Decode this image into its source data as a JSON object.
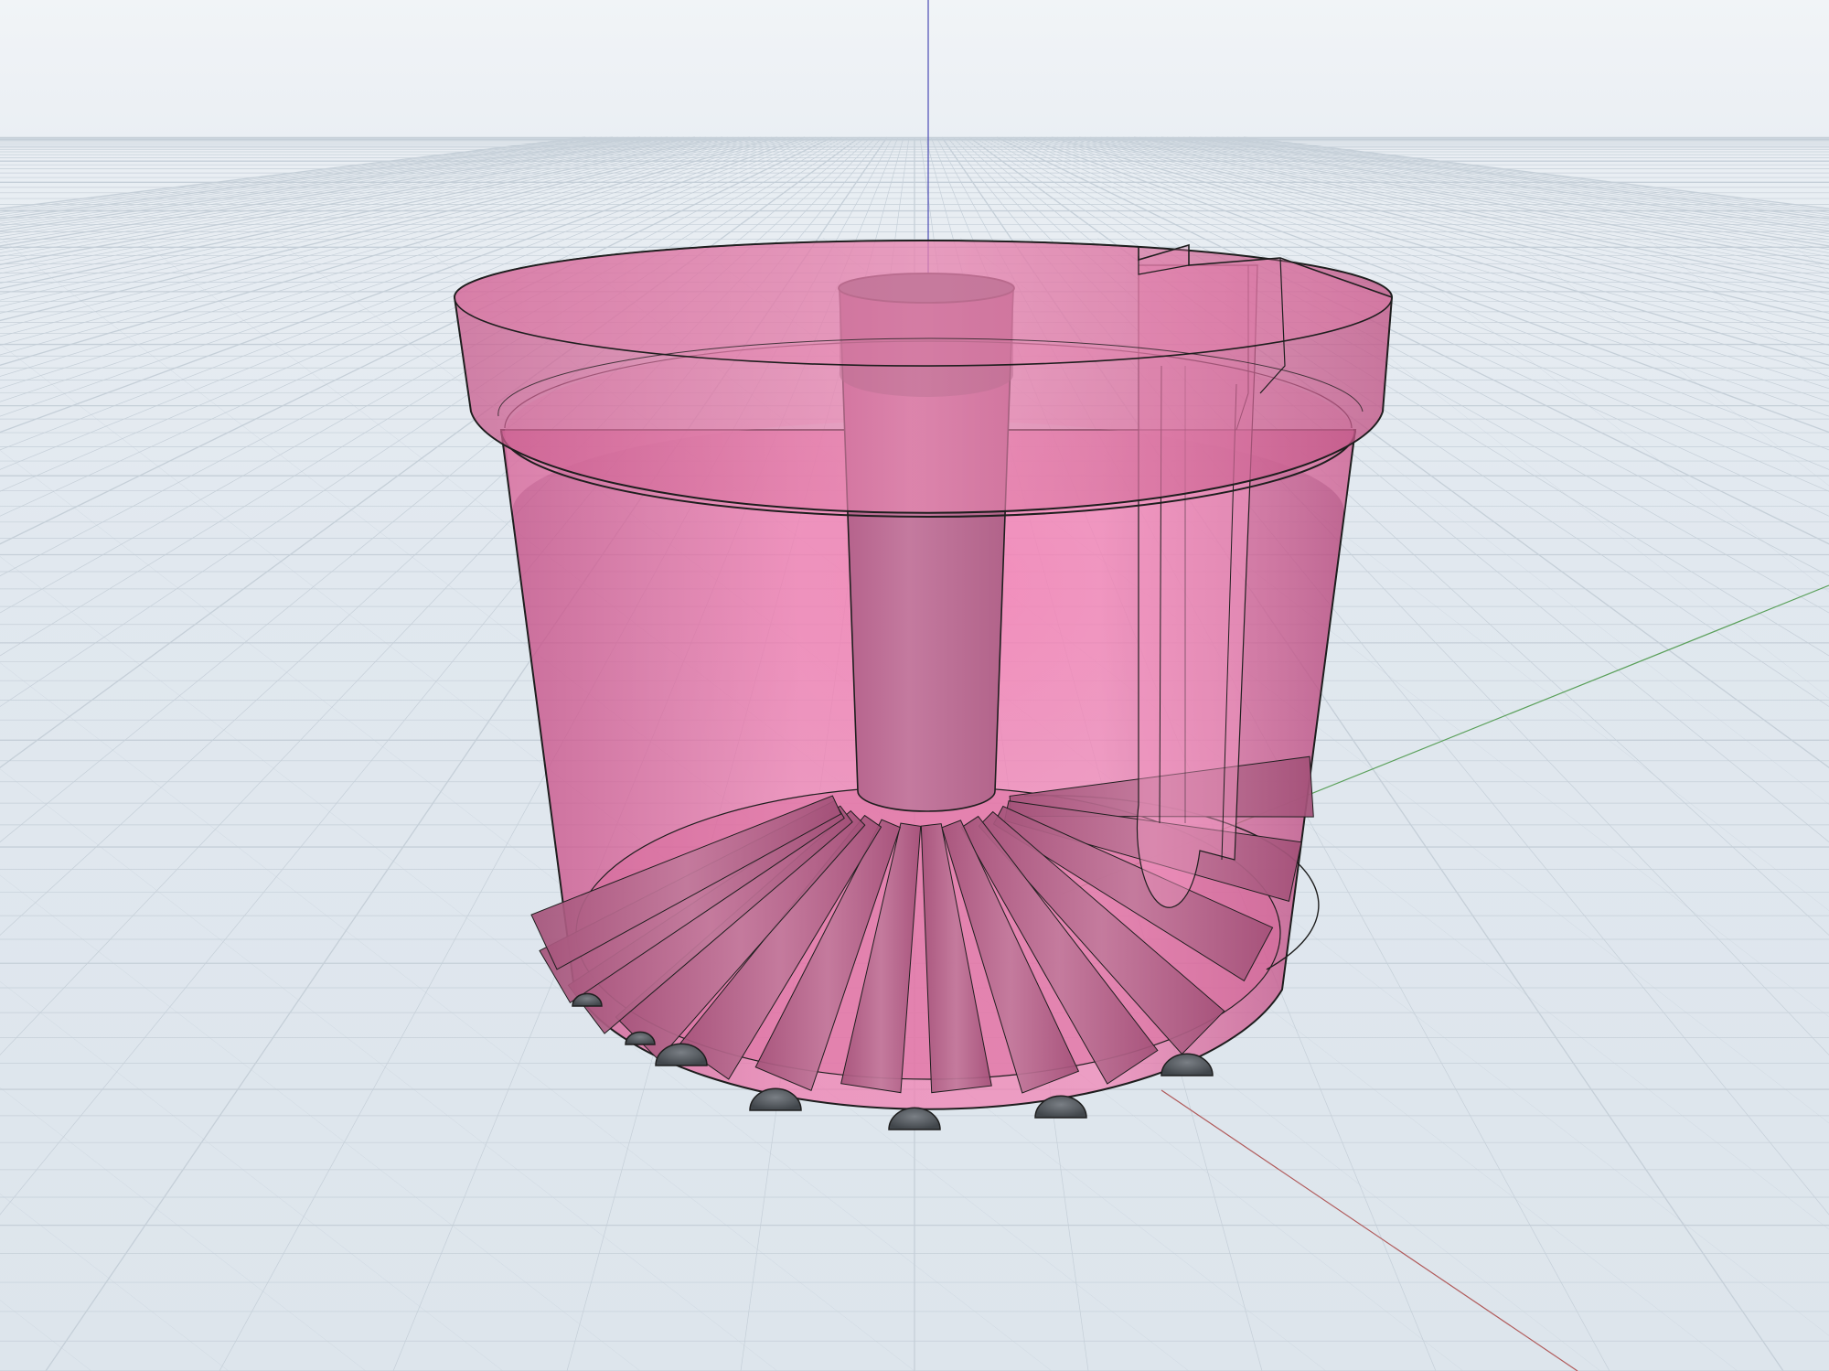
{
  "viewport": {
    "kind": "3d-cad-viewport",
    "background_color": "#e4ebf1",
    "grid_color": "#c5cfd8",
    "axes": {
      "x_color": "#b05a5a",
      "y_color": "#5aa05a",
      "z_color": "#4b4bb4"
    }
  },
  "model": {
    "shading": "transparent",
    "body_color": "#e0709e",
    "edge_color": "#1e1e1e",
    "hole_color": "#555a60",
    "features": [
      "outer-shell",
      "top-rim",
      "inner-shelf",
      "center-tube",
      "side-channel",
      "radial-ribs",
      "base-holes"
    ],
    "rib_count": 14,
    "visible_base_holes": 7
  }
}
